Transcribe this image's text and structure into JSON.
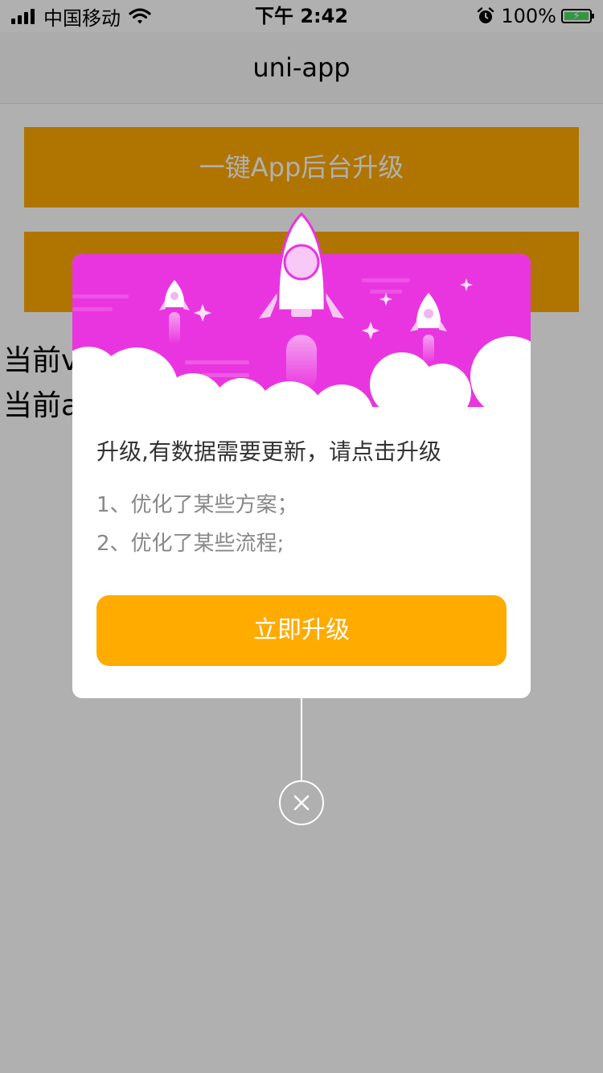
{
  "status_bar": {
    "carrier": "中国移动",
    "time": "下午 2:42",
    "battery": "100%",
    "battery_level": 1.0,
    "icons": [
      "signal-icon",
      "wifi-icon",
      "alarm-icon",
      "battery-icon"
    ]
  },
  "nav": {
    "title": "uni-app"
  },
  "page": {
    "button1_label": "一键App后台升级",
    "info1": "当前v",
    "info2": "当前a"
  },
  "popup": {
    "title": "升级,有数据需要更新，请点击升级",
    "notes": [
      "1、优化了某些方案；",
      "2、优化了某些流程;"
    ],
    "upgrade_label": "立即升级",
    "header_icons": [
      "rocket-icon",
      "cloud-icon",
      "sparkle-icon"
    ]
  },
  "colors": {
    "accent": "#ffab00",
    "header": "#e935e0",
    "mask": "rgba(0,0,0,0.31)"
  }
}
